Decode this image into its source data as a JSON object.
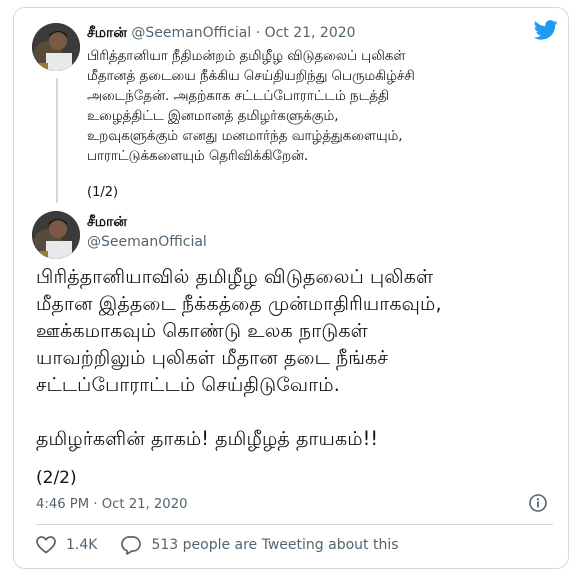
{
  "quoted": {
    "display_name": "சீமான்",
    "handle": "@SeemanOfficial",
    "dot": "·",
    "date": "Oct 21, 2020",
    "text_lines": [
      "பிரித்தானியா நீதிமன்றம் தமிழீழ விடுதலைப் புலிகள்",
      "மீதானத் தடையை நீக்கிய செய்தியறிந்து பெருமகிழ்ச்சி",
      "அடைந்தேன். அதற்காக சட்டப்போராட்டம் நடத்தி",
      "உழைத்திட்ட இனமானத் தமிழர்களுக்கும்,",
      "உறவுகளுக்கும் எனது மனமார்ந்த வாழ்த்துகளையும்,",
      "பாராட்டுக்களையும் தெரிவிக்கிறேன்."
    ],
    "thread_count": "(1/2)"
  },
  "main": {
    "display_name": "சீமான்",
    "handle": "@SeemanOfficial",
    "text_lines": [
      "பிரித்தானியாவில் தமிழீழ விடுதலைப் புலிகள்",
      "மீதான இத்தடை நீக்கத்தை முன்மாதிரியாகவும்,",
      "ஊக்கமாகவும் கொண்டு உலக நாடுகள்",
      "யாவற்றிலும் புலிகள் மீதான தடை நீங்கச்",
      "சட்டப்போராட்டம் செய்திடுவோம்.",
      "",
      "தமிழர்களின் தாகம்! தமிழீழத் தாயகம்!!"
    ],
    "thread_count": "(2/2)",
    "time": "4:46 PM",
    "dot": "·",
    "date": "Oct 21, 2020"
  },
  "actions": {
    "likes": "1.4K",
    "retweets": "513 people are Tweeting about this"
  },
  "colors": {
    "twitter_blue": "#1d9bf0",
    "muted": "#536471",
    "border": "#cfd9de"
  }
}
